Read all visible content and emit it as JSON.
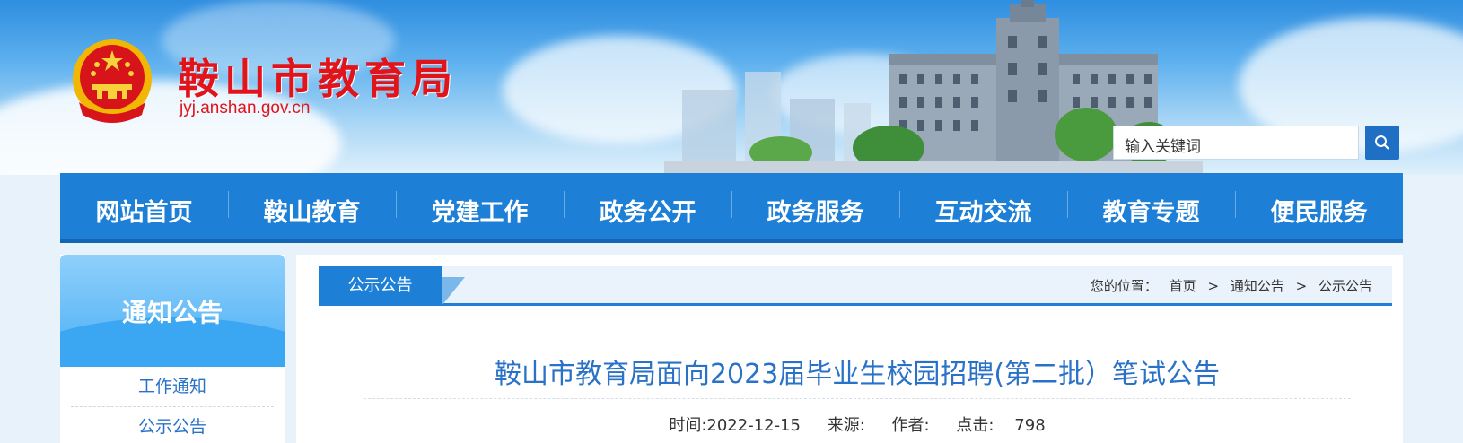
{
  "header": {
    "site_title": "鞍山市教育局",
    "site_domain": "jyj.anshan.gov.cn",
    "search_placeholder": "输入关键词"
  },
  "nav": {
    "items": [
      "网站首页",
      "鞍山教育",
      "党建工作",
      "政务公开",
      "政务服务",
      "互动交流",
      "教育专题",
      "便民服务"
    ]
  },
  "sidebar": {
    "title": "通知公告",
    "items": [
      "工作通知",
      "公示公告"
    ]
  },
  "breadcrumb": {
    "tab": "公示公告",
    "prefix": "您的位置：",
    "home": "首页",
    "sep": ">",
    "level1": "通知公告",
    "level2": "公示公告"
  },
  "article": {
    "title": "鞍山市教育局面向2023届毕业生校园招聘(第二批）笔试公告",
    "time": "时间:2022-12-15",
    "source": "来源:",
    "author": "作者:",
    "clicks": "点击:    798"
  },
  "colors": {
    "brand_red": "#e1141b",
    "nav_blue": "#1d7fd6",
    "link_blue": "#2a72c8"
  }
}
